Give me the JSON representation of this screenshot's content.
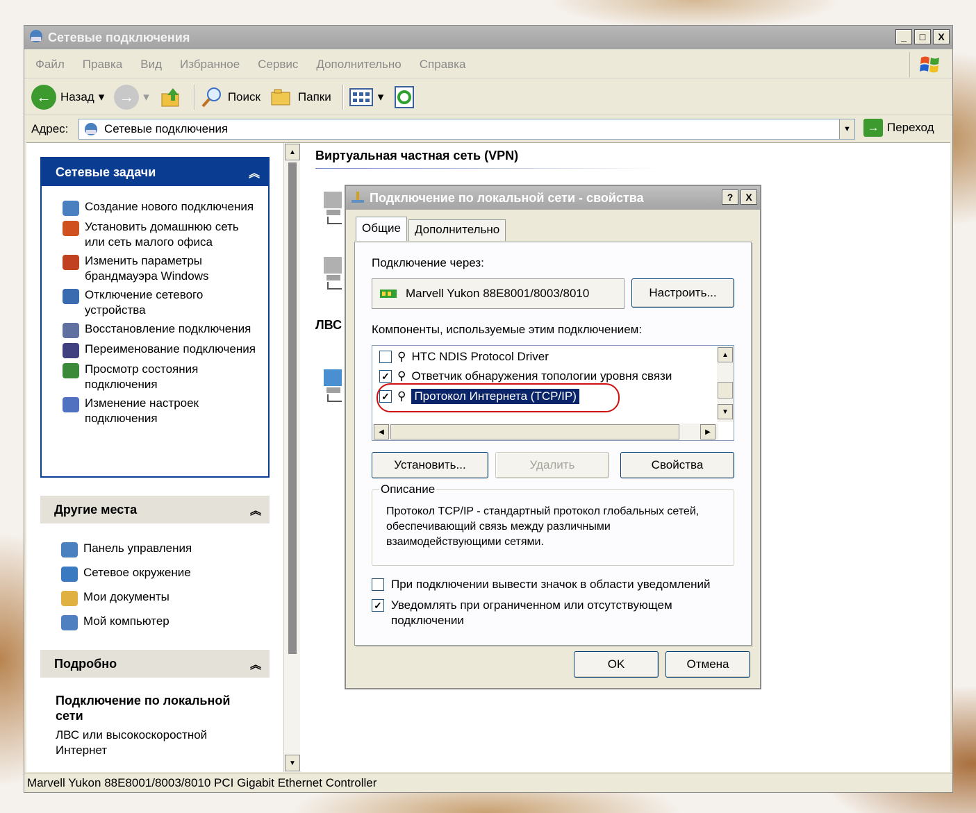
{
  "window": {
    "title": "Сетевые подключения",
    "min_btn": "_",
    "max_btn": "□",
    "close_btn": "X"
  },
  "menu": [
    "Файл",
    "Правка",
    "Вид",
    "Избранное",
    "Сервис",
    "Дополнительно",
    "Справка"
  ],
  "toolbar": {
    "back": "Назад",
    "search": "Поиск",
    "folders": "Папки"
  },
  "address": {
    "label": "Адрес:",
    "value": "Сетевые подключения",
    "go": "Переход"
  },
  "tasks_panel": {
    "title": "Сетевые задачи",
    "items": [
      {
        "label": "Создание нового подключения",
        "icon": "new-connection-icon",
        "color": "#4a7fc0"
      },
      {
        "label": "Установить домашнюю сеть или сеть малого офиса",
        "icon": "home-network-icon",
        "color": "#d05020"
      },
      {
        "label": "Изменить параметры брандмауэра Windows",
        "icon": "firewall-icon",
        "color": "#c04020"
      },
      {
        "label": "Отключение сетевого устройства",
        "icon": "disable-device-icon",
        "color": "#3a6ab0"
      },
      {
        "label": "Восстановление подключения",
        "icon": "repair-icon",
        "color": "#6070a0"
      },
      {
        "label": "Переименование подключения",
        "icon": "rename-icon",
        "color": "#404080"
      },
      {
        "label": "Просмотр состояния подключения",
        "icon": "status-icon",
        "color": "#3a8a3a"
      },
      {
        "label": "Изменение настроек подключения",
        "icon": "settings-icon",
        "color": "#5070c0"
      }
    ]
  },
  "places_panel": {
    "title": "Другие места",
    "items": [
      {
        "label": "Панель управления",
        "icon": "control-panel-icon",
        "color": "#4a80c0"
      },
      {
        "label": "Сетевое окружение",
        "icon": "network-places-icon",
        "color": "#3a7ac0"
      },
      {
        "label": "Мои документы",
        "icon": "my-documents-icon",
        "color": "#e0b040"
      },
      {
        "label": "Мой компьютер",
        "icon": "my-computer-icon",
        "color": "#5080c0"
      }
    ]
  },
  "details_panel": {
    "title": "Подробно",
    "name": "Подключение по локальной сети",
    "type": "ЛВС или высокоскоростной Интернет"
  },
  "main": {
    "group_vpn": "Виртуальная частная сеть (VPN)",
    "group_lan": "ЛВС"
  },
  "status": "Marvell Yukon 88E8001/8003/8010 PCI Gigabit Ethernet Controller",
  "dialog": {
    "title": "Подключение по локальной сети - свойства",
    "help_btn": "?",
    "close_btn": "X",
    "tabs": [
      "Общие",
      "Дополнительно"
    ],
    "connect_via_label": "Подключение через:",
    "adapter": "Marvell Yukon 88E8001/8003/8010",
    "configure_btn": "Настроить...",
    "components_label": "Компоненты, используемые этим подключением:",
    "components": [
      {
        "label": "HTC NDIS Protocol Driver",
        "checked": false
      },
      {
        "label": "Ответчик обнаружения топологии уровня связи",
        "checked": true
      },
      {
        "label": "Протокол Интернета (TCP/IP)",
        "checked": true,
        "selected": true
      }
    ],
    "install_btn": "Установить...",
    "remove_btn": "Удалить",
    "properties_btn": "Свойства",
    "description_legend": "Описание",
    "description": "Протокол TCP/IP - стандартный протокол глобальных сетей, обеспечивающий связь между различными взаимодействующими сетями.",
    "opt_show_icon": "При подключении вывести значок в области уведомлений",
    "opt_show_icon_checked": false,
    "opt_notify": "Уведомлять при ограниченном или отсутствующем подключении",
    "opt_notify_checked": true,
    "ok_btn": "OK",
    "cancel_btn": "Отмена"
  },
  "colors": {
    "panel_header_active": "#0a3d91",
    "panel_body": "#ffffff",
    "panel_header_inactive": "#e4e2d8",
    "selection": "#0a246a",
    "annotation_ring": "#d01010"
  }
}
